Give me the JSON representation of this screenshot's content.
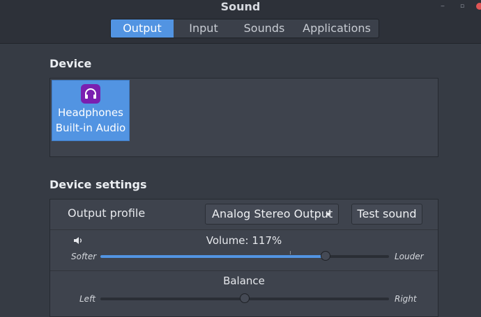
{
  "window": {
    "title": "Sound"
  },
  "tabs": [
    {
      "label": "Output",
      "active": true
    },
    {
      "label": "Input",
      "active": false
    },
    {
      "label": "Sounds",
      "active": false
    },
    {
      "label": "Applications",
      "active": false
    }
  ],
  "device_section": {
    "title": "Device",
    "devices": [
      {
        "name": "Headphones",
        "description": "Built-in Audio",
        "icon": "headphones-icon",
        "selected": true
      }
    ]
  },
  "settings_section": {
    "title": "Device settings",
    "output_profile": {
      "label": "Output profile",
      "value": "Analog Stereo Output"
    },
    "test_sound_label": "Test sound",
    "volume": {
      "label": "Volume: 117%",
      "value_percent": 117,
      "min_label": "Softer",
      "max_label": "Louder"
    },
    "balance": {
      "label": "Balance",
      "value": 0.5,
      "min_label": "Left",
      "max_label": "Right"
    }
  },
  "colors": {
    "accent": "#5294e2",
    "background": "#363b44",
    "panel": "#3e434d",
    "icon_bg": "#7a1fb0"
  }
}
